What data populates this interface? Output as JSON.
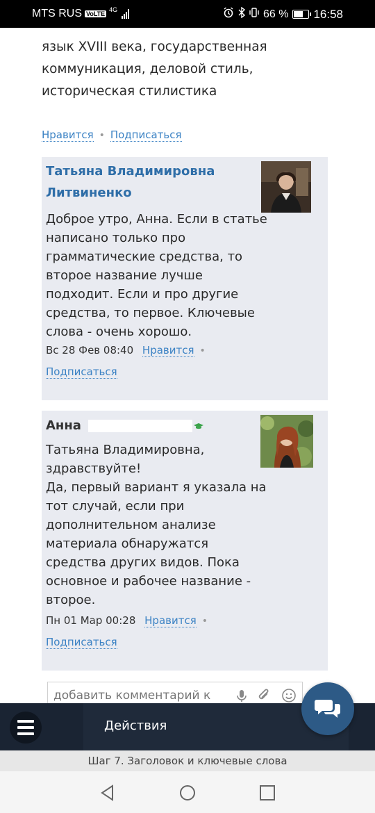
{
  "status_bar": {
    "carrier": "MTS RUS",
    "volte": "VoLTE",
    "network": "4G",
    "battery": "66 %",
    "battery_level": 0.66,
    "time": "16:58"
  },
  "article": {
    "text_lines": [
      "язык XVIII века, государственная",
      "коммуникация, деловой стиль,",
      "историческая стилистика"
    ],
    "like_label": "Нравится",
    "subscribe_label": "Подписаться"
  },
  "comments": [
    {
      "author": "Татьяна Владимировна Литвиненко",
      "body": "Доброе утро, Анна. Если в статье написано только про грамматические средства, то второе название лучше подходит. Если и про другие средства, то первое. Ключевые слова - очень хорошо.",
      "date": "Вс 28 Фев 08:40",
      "like_label": "Нравится",
      "subscribe_label": "Подписаться"
    },
    {
      "author": "Анна",
      "body_lines": [
        "Татьяна Владимировна,",
        "здравствуйте!",
        "Да, первый вариант я указала на тот случай, если при дополнительном анализе материала обнаружатся средства других видов. Пока основное и рабочее название - второе."
      ],
      "date": "Пн 01 Мар 00:28",
      "like_label": "Нравится",
      "subscribe_label": "Подписаться"
    }
  ],
  "comment_input": {
    "placeholder": "добавить комментарий к"
  },
  "bottom_nav": {
    "actions_label": "Действия"
  },
  "step_label": "Шаг 7. Заголовок и ключевые слова",
  "colors": {
    "link": "#3b82c4",
    "author": "#2f6ea8",
    "comment_bg": "#e9ebf1",
    "nav_bg": "#1f2a3a",
    "fab": "#2d5a86"
  }
}
